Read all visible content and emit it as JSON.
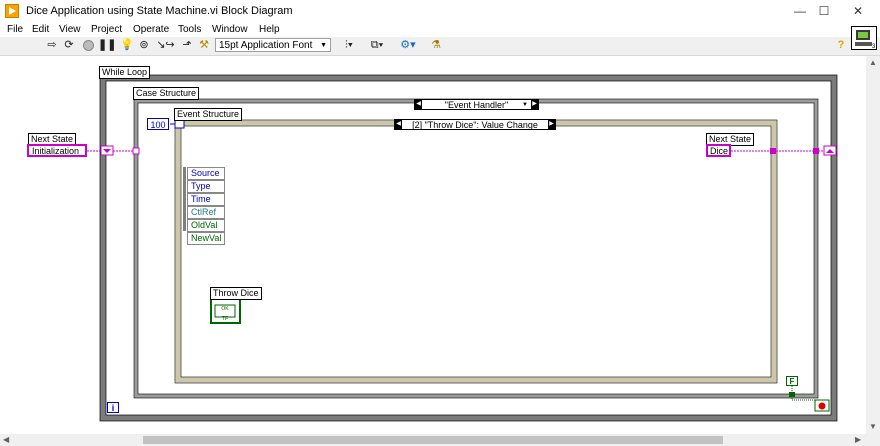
{
  "window": {
    "title": "Dice Application using State Machine.vi Block Diagram",
    "minimize": "—",
    "maximize": "☐",
    "close": "✕"
  },
  "menu": [
    "File",
    "Edit",
    "View",
    "Project",
    "Operate",
    "Tools",
    "Window",
    "Help"
  ],
  "toolbar": {
    "font": "15pt Application Font",
    "help_glyph": "?"
  },
  "diagram": {
    "while_loop_label": "While Loop",
    "case_structure_label": "Case Structure",
    "case_selector": "\"Event Handler\"",
    "event_structure_label": "Event Structure",
    "timeout_constant": "100",
    "event_selector": "[2] \"Throw Dice\": Value Change",
    "event_data_nodes": [
      "Source",
      "Type",
      "Time",
      "CtlRef",
      "OldVal",
      "NewVal"
    ],
    "left_control": {
      "label": "Next State",
      "value": "Initialization"
    },
    "right_constant": {
      "label": "Next State",
      "value": "Dice"
    },
    "button_terminal_label": "Throw Dice",
    "button_terminal_glyph": "OK",
    "button_terminal_type": "TF",
    "iteration_terminal": "i",
    "stop_constant": "F"
  },
  "colors": {
    "enum_wire": "#cc00cc",
    "numeric_blue": "#0000cc",
    "boolean_green": "#006600",
    "structure_gray": "#7b7b7b",
    "event_frame": "#ccc7a8"
  }
}
